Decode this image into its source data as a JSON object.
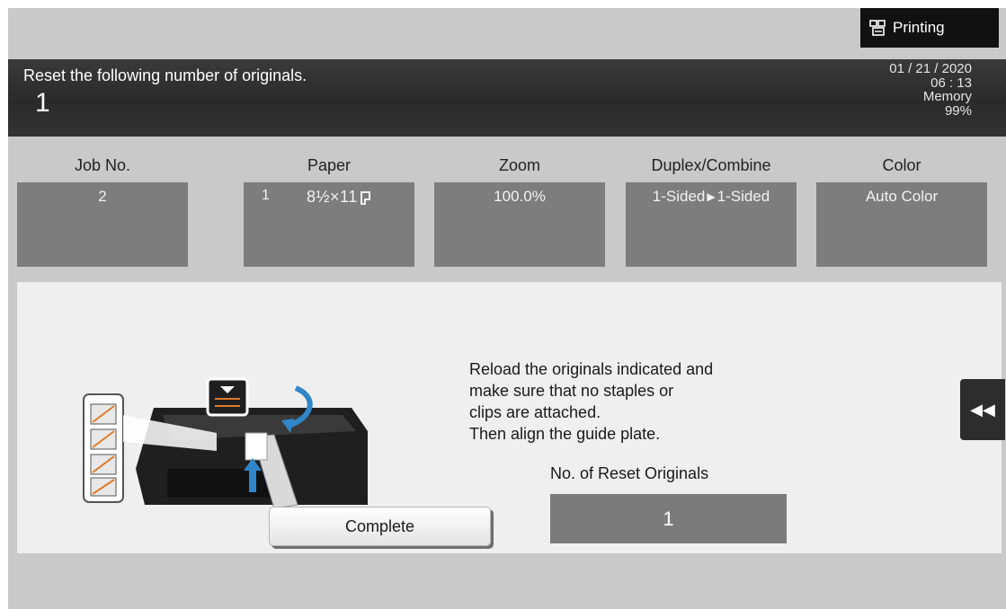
{
  "status_chip": {
    "label": "Printing",
    "icon": "printer-queue-icon"
  },
  "header": {
    "message": "Reset the following number of originals.",
    "count": "1",
    "date": "01 / 21 / 2020",
    "time": "06 : 13",
    "memory_label": "Memory",
    "memory_value": "99%"
  },
  "settings": {
    "job_no": {
      "title": "Job No.",
      "value": "2"
    },
    "paper": {
      "title": "Paper",
      "tray": "1",
      "size": "8½×11",
      "orientation_icon": "portrait-page-icon"
    },
    "zoom": {
      "title": "Zoom",
      "value": "100.0%"
    },
    "duplex": {
      "title": "Duplex/Combine",
      "from": "1-Sided",
      "to": "1-Sided"
    },
    "color": {
      "title": "Color",
      "value": "Auto Color"
    }
  },
  "panel": {
    "instruction_lines": [
      "Reload the originals indicated and",
      "make sure that no staples or",
      "clips are attached.",
      "Then align the guide plate."
    ],
    "reset_label": "No. of Reset Originals",
    "reset_value": "1",
    "complete_label": "Complete",
    "side_tab_icon": "double-chevron-left-icon"
  },
  "colors": {
    "header_bg": "#2f2f2f",
    "screen_bg": "#c9c9c9",
    "value_box": "#7d7d7d",
    "panel_bg": "#efefef"
  }
}
